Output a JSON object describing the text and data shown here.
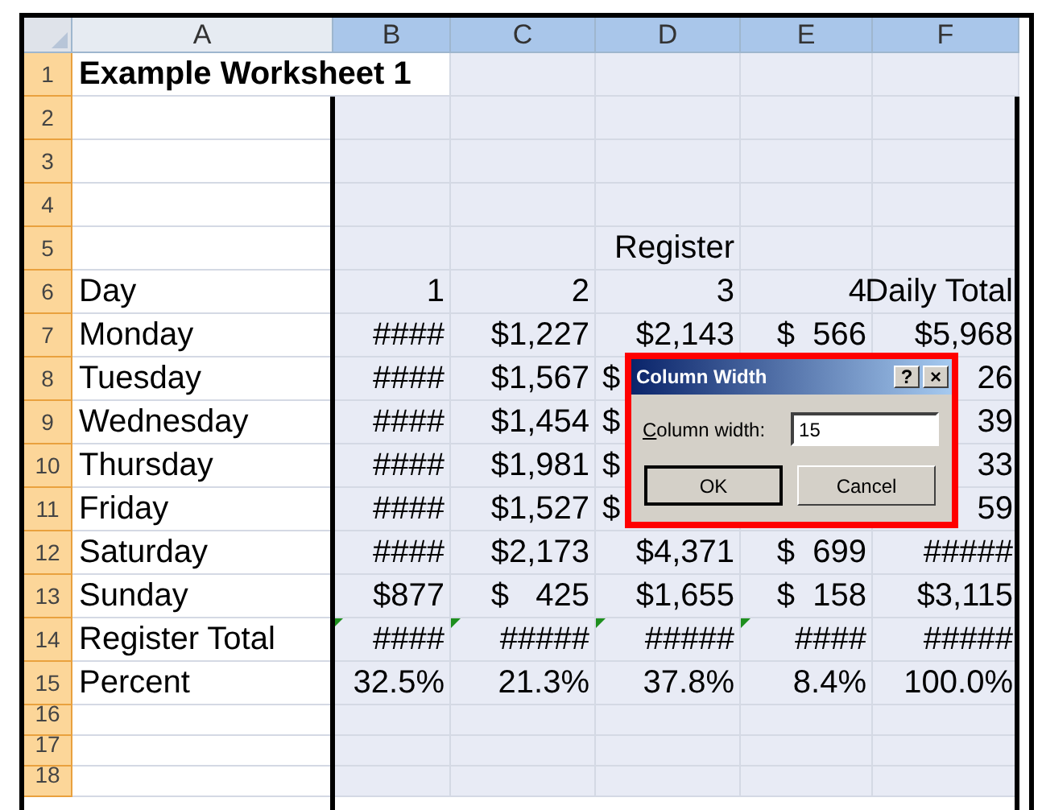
{
  "column_headers": [
    {
      "label": "A",
      "selected": false
    },
    {
      "label": "B",
      "selected": true
    },
    {
      "label": "C",
      "selected": true
    },
    {
      "label": "D",
      "selected": true
    },
    {
      "label": "E",
      "selected": true
    },
    {
      "label": "F",
      "selected": true
    }
  ],
  "rows": [
    {
      "number": "1",
      "selected": true,
      "has_active_cell": true,
      "bold": true,
      "cells": {
        "a": "Example Worksheet 1"
      }
    },
    {
      "number": "2",
      "selected": true
    },
    {
      "number": "3",
      "selected": true
    },
    {
      "number": "4",
      "selected": true
    },
    {
      "number": "5",
      "selected": true,
      "cells": {
        "d": "Register"
      }
    },
    {
      "number": "6",
      "selected": true,
      "cells": {
        "a": "Day",
        "b": "1",
        "c": "2",
        "d": "3",
        "e": "4",
        "f": "Daily Total"
      }
    },
    {
      "number": "7",
      "selected": true,
      "cells": {
        "a": "Monday",
        "b": "####",
        "c": "$1,227",
        "d": "$2,143",
        "e": "$  566",
        "f": "$5,968"
      }
    },
    {
      "number": "8",
      "selected": true,
      "cells": {
        "a": "Tuesday",
        "b": "####",
        "c": "$1,567",
        "d": {
          "text": "$",
          "kind": "symbol"
        },
        "f": "26"
      }
    },
    {
      "number": "9",
      "selected": true,
      "cells": {
        "a": "Wednesday",
        "b": "####",
        "c": "$1,454",
        "d": {
          "text": "$",
          "kind": "symbol"
        },
        "f": "39"
      }
    },
    {
      "number": "10",
      "selected": true,
      "cells": {
        "a": "Thursday",
        "b": "####",
        "c": "$1,981",
        "d": {
          "text": "$",
          "kind": "symbol"
        },
        "f": "33"
      }
    },
    {
      "number": "11",
      "selected": true,
      "cells": {
        "a": "Friday",
        "b": "####",
        "c": "$1,527",
        "d": {
          "text": "$",
          "kind": "symbol"
        },
        "f": "59"
      }
    },
    {
      "number": "12",
      "selected": true,
      "cells": {
        "a": "Saturday",
        "b": "####",
        "c": "$2,173",
        "d": "$4,371",
        "e": "$  699",
        "f": "#####"
      }
    },
    {
      "number": "13",
      "selected": true,
      "cells": {
        "a": "Sunday",
        "b": "$877",
        "c": "$   425",
        "d": "$1,655",
        "e": "$  158",
        "f": "$3,115"
      }
    },
    {
      "number": "14",
      "selected": true,
      "error_marks": {
        "b": true,
        "c": true,
        "d": true,
        "e": true,
        "f": false
      },
      "cells": {
        "a": "Register Total",
        "b": "####",
        "c": "#####",
        "d": "#####",
        "e": "####",
        "f": "#####"
      }
    },
    {
      "number": "15",
      "selected": true,
      "cells": {
        "a": "Percent",
        "b": "32.5%",
        "c": "21.3%",
        "d": "37.8%",
        "e": "8.4%",
        "f": "100.0%"
      }
    },
    {
      "number": "16",
      "selected": true,
      "small": true
    },
    {
      "number": "17",
      "selected": true,
      "small": true
    },
    {
      "number": "18",
      "selected": true,
      "small": true
    }
  ],
  "dialog": {
    "title": "Column Width",
    "help_button": "?",
    "close_button": "×",
    "highlighted": true,
    "label": "Column width:",
    "value": "15",
    "buttons": [
      {
        "label": "OK",
        "default": true
      },
      {
        "label": "Cancel",
        "default": false
      }
    ]
  }
}
